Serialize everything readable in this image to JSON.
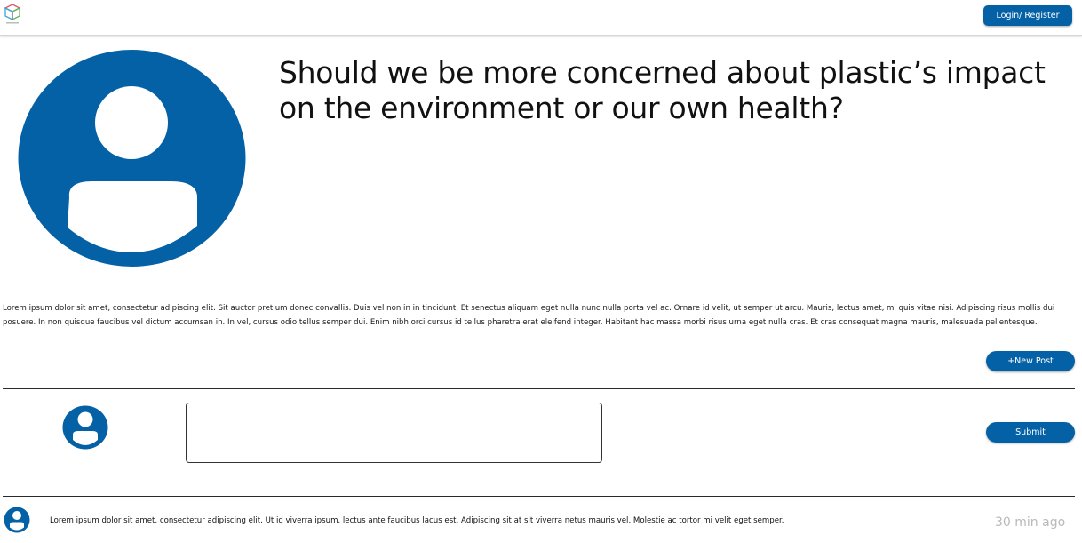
{
  "header": {
    "login_label": "Login/ Register",
    "brand_color": "#0561a6"
  },
  "post": {
    "title": "Should we be more concerned about plastic’s impact on the environment or our own health?",
    "description": "Lorem ipsum dolor sit amet, consectetur adipiscing elit. Sit auctor pretium donec convallis. Duis vel non in in tincidunt. Et senectus aliquam eget nulla nunc nulla porta vel ac. Ornare id velit, ut semper ut arcu. Mauris, lectus amet, mi quis vitae nisi. Adipiscing risus mollis dui posuere. In non quisque faucibus vel dictum accumsan in. In vel, cursus odio tellus semper dui. Enim nibh orci cursus id tellus pharetra erat eleifend integer. Habitant hac massa morbi risus urna eget nulla cras. Et cras consequat magna mauris, malesuada pellentesque.",
    "avatar_icon": "user-circle-icon",
    "new_post_label": "+New Post"
  },
  "comment_form": {
    "input_value": "",
    "input_placeholder": "",
    "submit_label": "Submit",
    "avatar_icon": "user-circle-icon"
  },
  "replies": [
    {
      "avatar_icon": "user-circle-icon",
      "text": "Lorem ipsum dolor sit amet, consectetur adipiscing elit. Ut id viverra ipsum, lectus ante faucibus lacus est. Adipiscing sit at sit viverra netus mauris vel. Molestie ac tortor mi velit eget semper.",
      "time": "30 min ago"
    }
  ]
}
